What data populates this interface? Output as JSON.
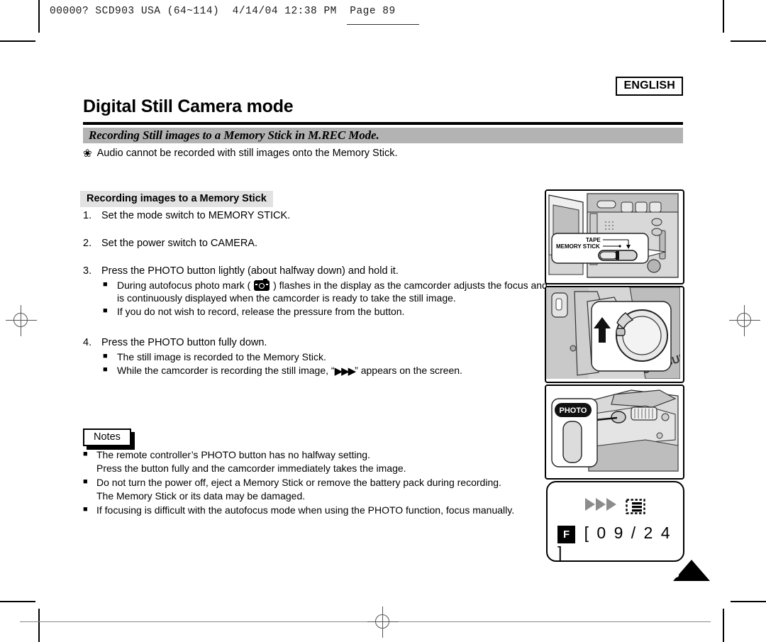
{
  "slug": {
    "line": "00000? SCD903 USA (64~114)  4/14/04 12:38 PM  Page 89"
  },
  "header": {
    "language_badge": "ENGLISH",
    "page_title": "Digital Still Camera mode",
    "section_title": "Recording Still images to a Memory Stick in M.REC Mode.",
    "audio_note": "Audio cannot be recorded with still images onto the Memory Stick.",
    "clover_glyph": "❀"
  },
  "procedure": {
    "chip_label": "Recording images to a Memory Stick",
    "bullet_glyph": "■",
    "steps": [
      {
        "num": "1.",
        "text": "Set the mode switch to MEMORY STICK.",
        "sub": []
      },
      {
        "num": "2.",
        "text": "Set the power switch to CAMERA.",
        "sub": []
      },
      {
        "num": "3.",
        "text": "Press the PHOTO button lightly (about halfway down) and hold it.",
        "sub": [
          "During autofocus photo mark (  ) flashes in the display as the camcorder adjusts the focus and is continuously displayed when the camcorder is ready to take the still image.",
          "If you do not wish to record, release the pressure from the button."
        ],
        "sub_parts": {
          "a_before": "During autofocus photo mark ( ",
          "a_after": " ) flashes in the display as the camcorder adjusts the focus and is continuously displayed when the camcorder is ready to take the still image.",
          "icon_name": "photo-mark-icon"
        }
      },
      {
        "num": "4.",
        "text": "Press the PHOTO button fully down.",
        "sub": [
          "The still image is recorded to the Memory Stick.",
          "While the camcorder is recording the still image, “▶▶▶” appears on the screen."
        ],
        "sub_parts": {
          "b_before": "While the camcorder is recording the still image, “",
          "b_glyph": "▶▶▶",
          "b_after": "” appears on the screen."
        }
      }
    ]
  },
  "notes": {
    "title": "Notes",
    "bullet_glyph": "■",
    "items": [
      "The remote controller’s PHOTO button has no halfway setting.\nPress the button fully and the camcorder immediately takes the image.",
      "Do not turn the power off, eject a Memory Stick or remove the battery pack during recording.\nThe Memory Stick or its data may be damaged.",
      "If focusing is difficult with the autofocus mode when using the PHOTO function, focus manually."
    ],
    "items_lines": [
      [
        "The remote controller’s PHOTO button has no halfway setting.",
        "Press the button fully and the camcorder immediately takes the image."
      ],
      [
        "Do not turn the power off, eject a Memory Stick or remove the battery pack during recording.",
        "The Memory Stick or its data may be damaged."
      ],
      [
        "If focusing is difficult with the autofocus mode when using the PHOTO function, focus manually."
      ]
    ]
  },
  "figures": {
    "fig1": {
      "name": "mode-switch-figure",
      "caption_tape": "TAPE",
      "caption_memory_stick": "MEMORY STICK"
    },
    "fig2": {
      "name": "power-switch-figure",
      "brand_text": "SAMSUNG"
    },
    "fig3": {
      "name": "photo-button-figure",
      "button_label": "PHOTO"
    },
    "fig4": {
      "name": "lcd-display-figure",
      "arrow_glyph": "▶",
      "arrow_count": 3,
      "mode_badge": "F",
      "counter": "[ 0 9 / 2 4 ]"
    }
  },
  "footer": {
    "page_number": "89"
  },
  "colors": {
    "section_bar": "#b3b3b3",
    "chip_bg": "#e2e2e2",
    "lcd_arrow": "#8c8c8c",
    "ink": "#000000"
  }
}
